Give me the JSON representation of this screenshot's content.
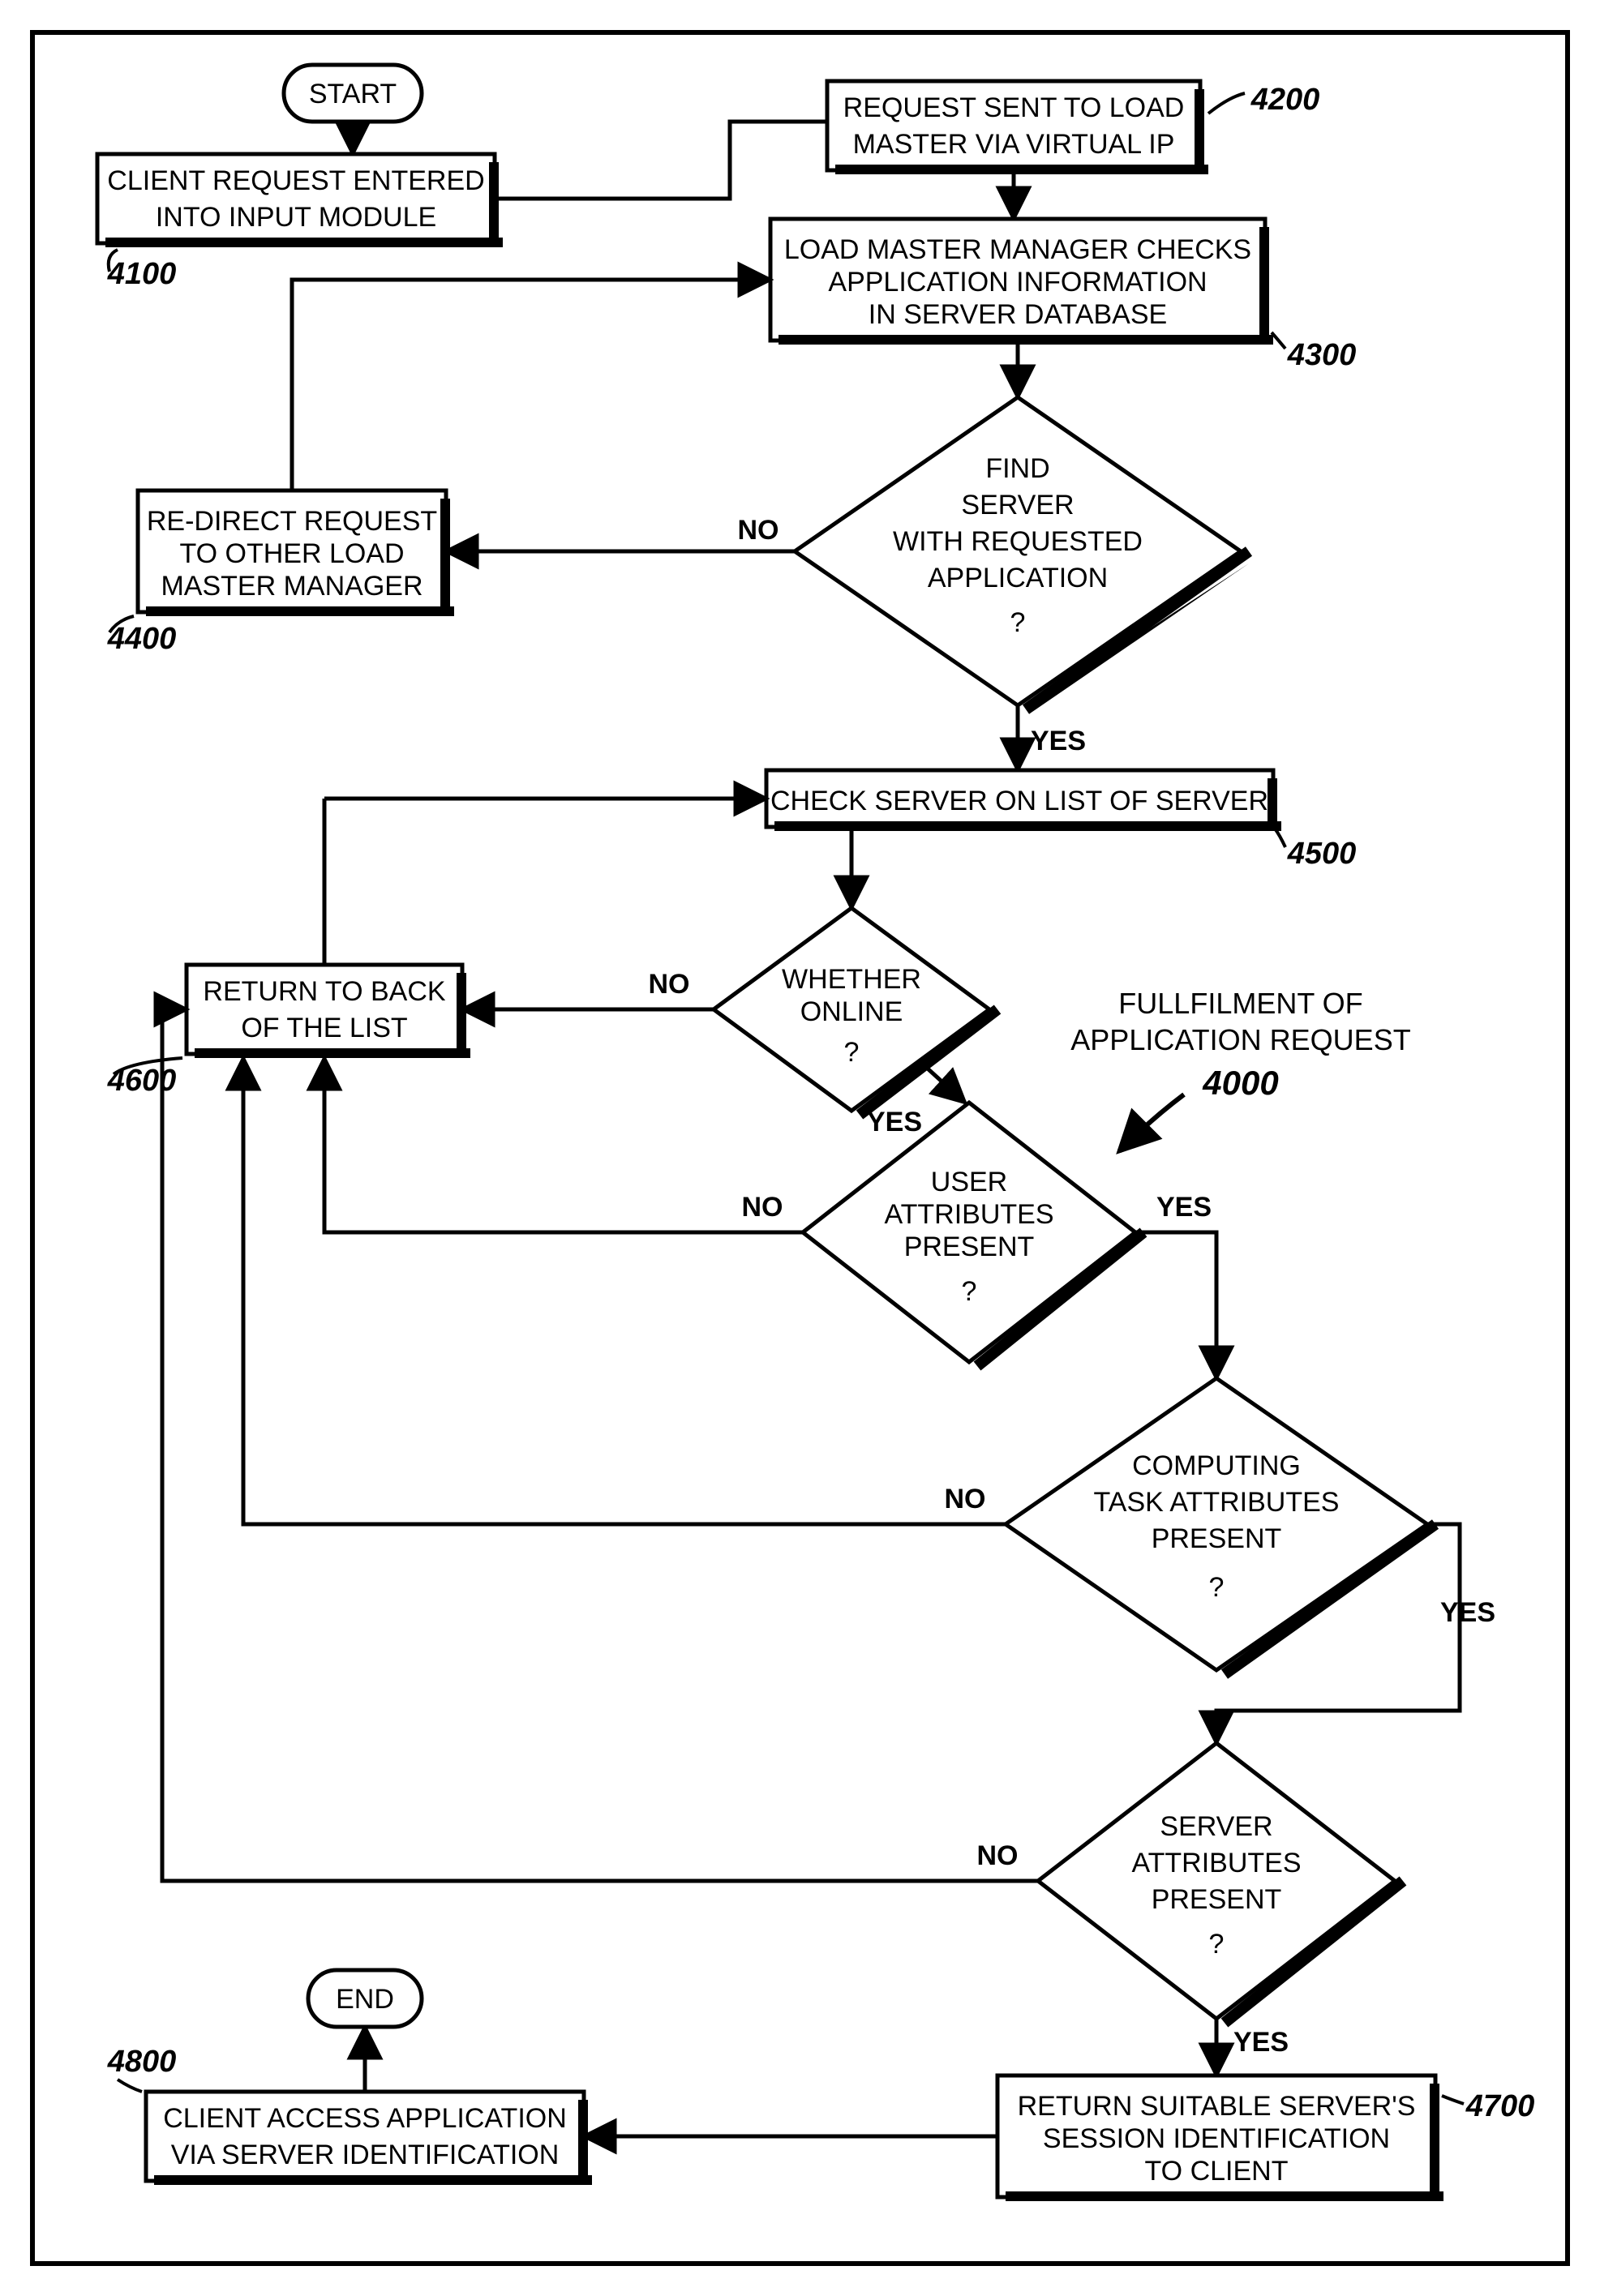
{
  "terminals": {
    "start": "START",
    "end": "END"
  },
  "boxes": {
    "b4100": {
      "lines": [
        "CLIENT REQUEST ENTERED",
        "INTO INPUT MODULE"
      ],
      "ref": "4100"
    },
    "b4200": {
      "lines": [
        "REQUEST SENT TO LOAD",
        "MASTER VIA VIRTUAL IP"
      ],
      "ref": "4200"
    },
    "b4300": {
      "lines": [
        "LOAD MASTER MANAGER CHECKS",
        "APPLICATION INFORMATION",
        "IN SERVER DATABASE"
      ],
      "ref": "4300"
    },
    "b4400": {
      "lines": [
        "RE-DIRECT REQUEST",
        "TO OTHER LOAD",
        "MASTER MANAGER"
      ],
      "ref": "4400"
    },
    "b4500": {
      "lines": [
        "CHECK SERVER ON LIST OF SERVER"
      ],
      "ref": "4500"
    },
    "b4600": {
      "lines": [
        "RETURN TO BACK",
        "OF THE LIST"
      ],
      "ref": "4600"
    },
    "b4700": {
      "lines": [
        "RETURN SUITABLE SERVER'S",
        "SESSION IDENTIFICATION",
        "TO CLIENT"
      ],
      "ref": "4700"
    },
    "b4800": {
      "lines": [
        "CLIENT ACCESS APPLICATION",
        "VIA SERVER IDENTIFICATION"
      ],
      "ref": "4800"
    }
  },
  "decisions": {
    "d1": {
      "lines": [
        "FIND",
        "SERVER",
        "WITH REQUESTED",
        "APPLICATION",
        "?"
      ]
    },
    "d2": {
      "lines": [
        "WHETHER",
        "ONLINE",
        "?"
      ]
    },
    "d3": {
      "lines": [
        "USER",
        "ATTRIBUTES",
        "PRESENT",
        "?"
      ]
    },
    "d4": {
      "lines": [
        "COMPUTING",
        "TASK ATTRIBUTES",
        "PRESENT",
        "?"
      ]
    },
    "d5": {
      "lines": [
        "SERVER",
        "ATTRIBUTES",
        "PRESENT",
        "?"
      ]
    }
  },
  "edges": {
    "no": "NO",
    "yes": "YES"
  },
  "annotation": {
    "title_l1": "FULLFILMENT OF",
    "title_l2": "APPLICATION REQUEST",
    "title_ref": "4000"
  }
}
